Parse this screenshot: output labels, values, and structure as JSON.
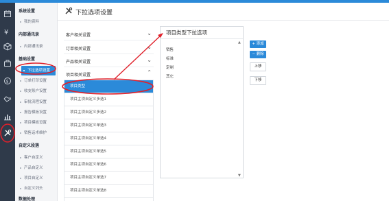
{
  "header": {
    "title": "下拉选项设置",
    "icon": "tools-icon"
  },
  "iconbar": {
    "icons": [
      "calendar-icon",
      "currency-icon",
      "package-icon",
      "briefcase-icon",
      "coin-icon",
      "handshake-icon",
      "chart-icon",
      "tools-icon"
    ]
  },
  "sidebar": {
    "group1": "系统设置",
    "item_profile": "我的资料",
    "group2": "内部通讯录",
    "item_contacts": "内部通讯录",
    "group3": "基础设置",
    "item_dropdown": "下拉选项设置",
    "item_order_print": "订单打印设置",
    "item_account": "收支账户设置",
    "item_approval": "审批流程设置",
    "item_report": "报告模板设置",
    "item_project_tpl": "项目模板设置",
    "item_phrases": "销售话术维护",
    "group4": "自定义段落",
    "item_custom_customer": "客户自定义",
    "item_custom_product": "产品自定义",
    "item_custom_project": "项目自定义",
    "item_custom_list": "自定义列头",
    "group5": "数据处理"
  },
  "categories": [
    {
      "label": "客户相关设置",
      "expanded": false
    },
    {
      "label": "订单相关设置",
      "expanded": false
    },
    {
      "label": "产品相关设置",
      "expanded": false
    },
    {
      "label": "项目相关设置",
      "expanded": true
    }
  ],
  "project_options": [
    "项目类型",
    "项目主项自定义多选1",
    "项目主项自定义多选2",
    "项目主项自定义单选3",
    "项目主项自定义单选4",
    "项目主项自定义单选5",
    "项目主项自定义单选6",
    "项目主项自定义单选7",
    "项目主项自定义单选8"
  ],
  "panel": {
    "title": "项目类型下拉选项",
    "values": [
      "销售",
      "标准",
      "定制",
      "其它"
    ]
  },
  "buttons": {
    "add": "添加",
    "delete": "删除",
    "move_up": "上移",
    "move_down": "下移"
  },
  "colors": {
    "accent": "#2b8ad9",
    "annotation": "#e0202a",
    "iconbar": "#2f3a4a"
  }
}
